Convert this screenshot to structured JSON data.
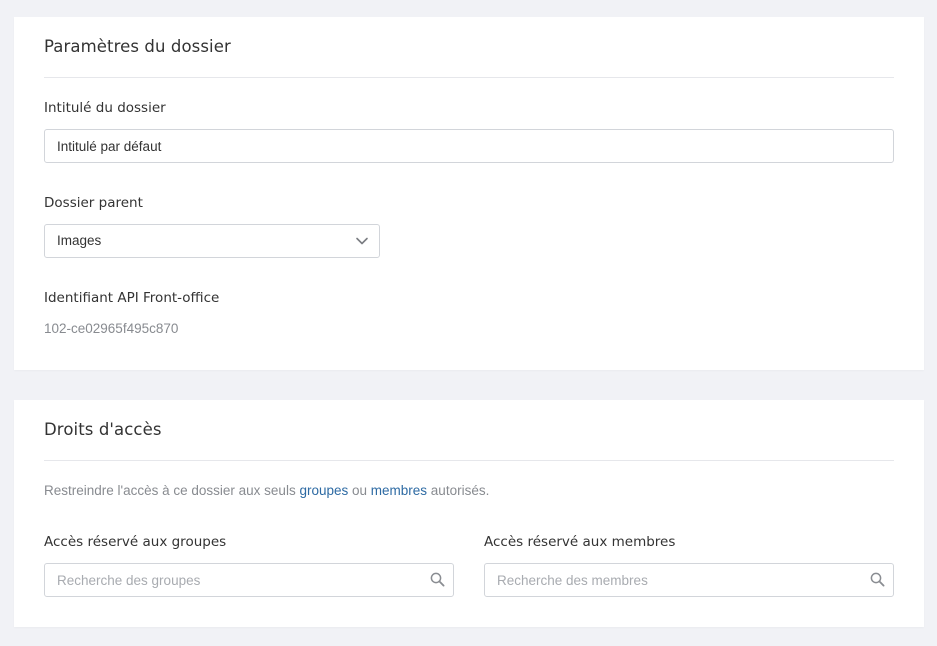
{
  "settings": {
    "title": "Paramètres du dossier",
    "folder_name_label": "Intitulé du dossier",
    "folder_name_value": "Intitulé par défaut",
    "parent_label": "Dossier parent",
    "parent_value": "Images",
    "api_label": "Identifiant API Front-office",
    "api_value": "102-ce02965f495c870"
  },
  "access": {
    "title": "Droits d'accès",
    "description_prefix": "Restreindre l'accès à ce dossier aux seuls ",
    "groups_link": "groupes",
    "description_mid": " ou ",
    "members_link": "membres",
    "description_suffix": " autorisés.",
    "groups_label": "Accès réservé aux groupes",
    "groups_placeholder": "Recherche des groupes",
    "members_label": "Accès réservé aux membres",
    "members_placeholder": "Recherche des membres"
  },
  "colors": {
    "background": "#f1f2f6",
    "panel": "#ffffff",
    "link": "#2d6aa3",
    "muted_text": "#888b90",
    "border": "#d2d5da"
  },
  "icons": {
    "select_chevron": "chevron-down-icon",
    "search": "search-icon"
  }
}
